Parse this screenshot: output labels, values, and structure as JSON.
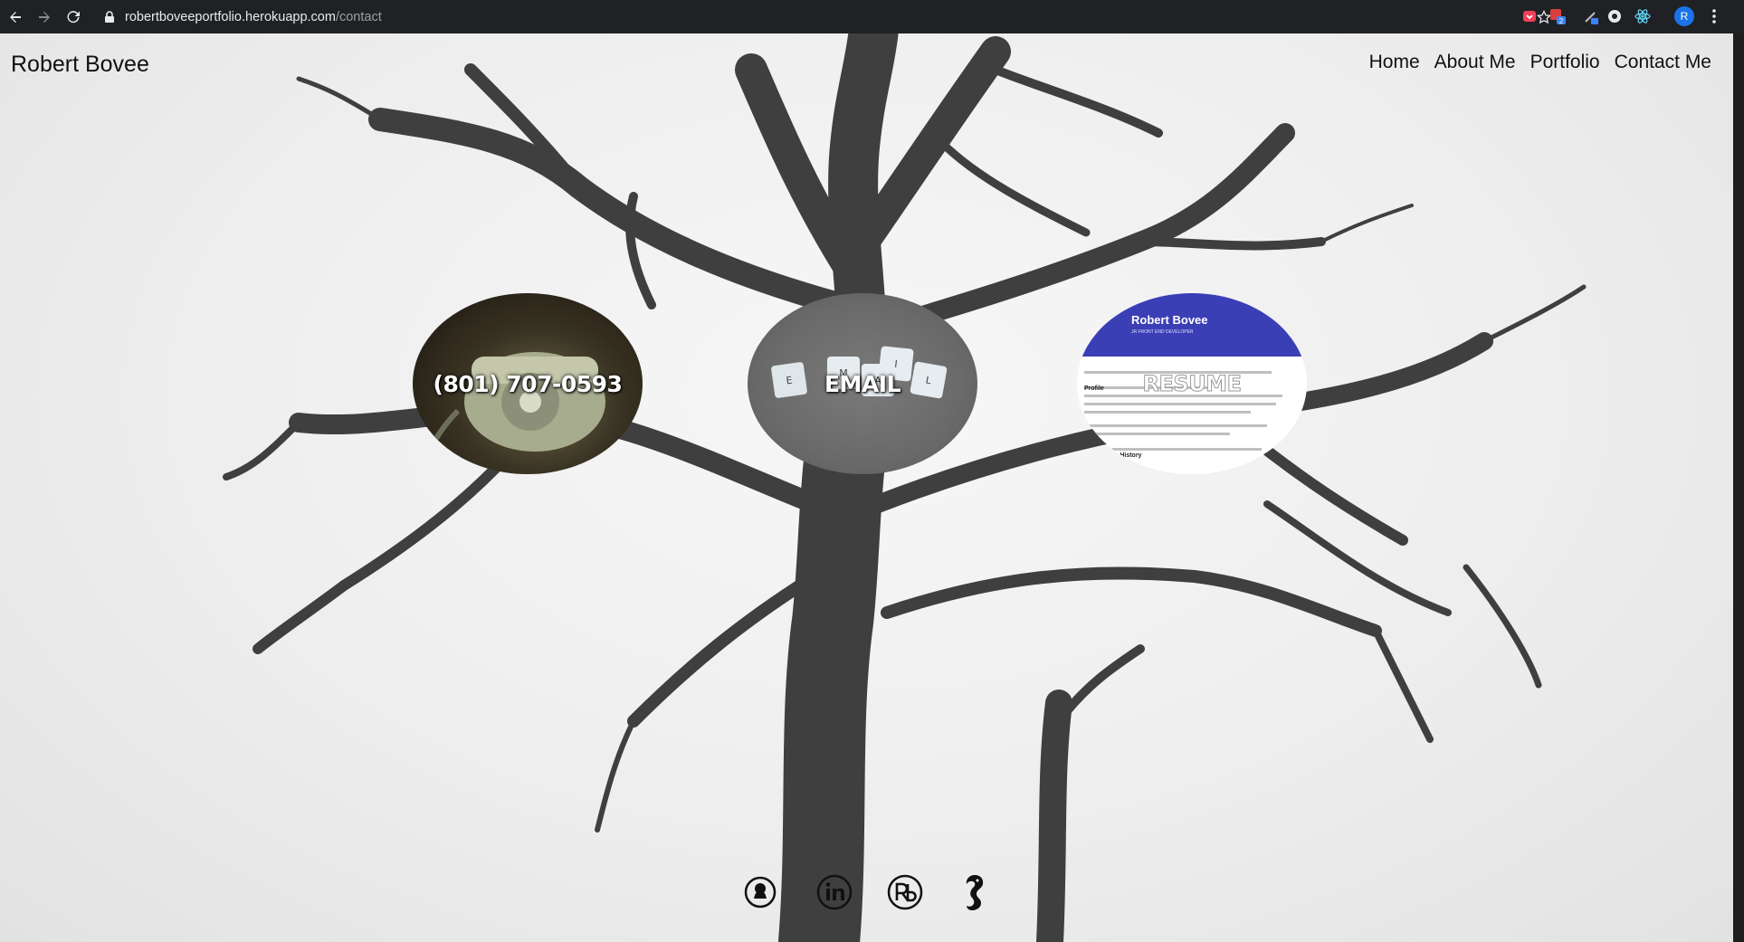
{
  "browser": {
    "url_host": "robertboveeportfolio.herokuapp.com",
    "url_path": "/contact",
    "profile_initial": "R",
    "extension_badge": "2"
  },
  "site": {
    "brand": "Robert Bovee",
    "nav": [
      "Home",
      "About Me",
      "Portfolio",
      "Contact Me"
    ]
  },
  "contact": {
    "phone_label": "(801) 707-0593",
    "email_label": "EMAIL",
    "resume_label": "RESUME",
    "resume_preview_name": "Robert Bovee",
    "resume_preview_subtitle": "JR FRONT END DEVELOPER",
    "resume_preview_sections": [
      "Profile",
      "Work History"
    ]
  },
  "tiles": [
    "E",
    "M",
    "A",
    "I",
    "L"
  ],
  "social_icons": [
    "github-icon",
    "linkedin-icon",
    "rb-logo-icon",
    "seahorse-logo-icon"
  ]
}
